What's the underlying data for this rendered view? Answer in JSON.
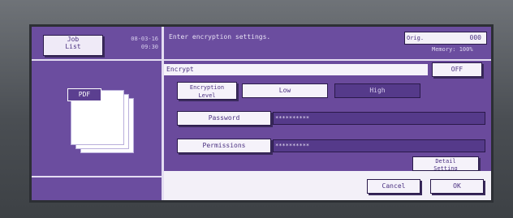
{
  "job": {
    "label_line1": "Job",
    "label_line2": "List"
  },
  "datetime": {
    "date": "08-03-16",
    "time": "09:30"
  },
  "preview": {
    "file_type": "PDF"
  },
  "message": "Enter encryption settings.",
  "counter": {
    "label": "Orig.",
    "value": "000"
  },
  "memory": "Memory: 100%",
  "encrypt": {
    "label": "Encrypt",
    "off_label": "OFF"
  },
  "level": {
    "label_line1": "Encryption",
    "label_line2": "Level",
    "options": [
      "Low",
      "High"
    ],
    "selected": "High"
  },
  "password": {
    "label": "Password",
    "value": "**********"
  },
  "permissions": {
    "label": "Permissions",
    "value": "**********"
  },
  "detail": {
    "label_line1": "Detail",
    "label_line2": "Setting"
  },
  "footer": {
    "cancel_label": "Cancel",
    "ok_label": "OK"
  },
  "colors": {
    "screen_bg": "#6a4a9c",
    "button_bg": "#f5f2fa",
    "selected_bg": "#553a8a"
  }
}
